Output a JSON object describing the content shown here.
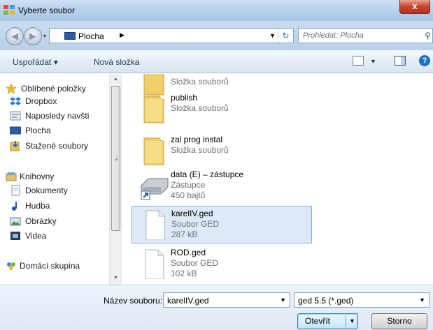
{
  "window": {
    "title": "Vyberte soubor",
    "close_label": "x"
  },
  "address": {
    "location": "Plocha",
    "search_placeholder": "Prohledat: Plocha"
  },
  "toolbar": {
    "organize_label": "Uspořádat ▾",
    "new_folder_label": "Nová složka"
  },
  "sidebar": {
    "favorites": {
      "label": "Oblíbené položky",
      "items": [
        {
          "label": "Dropbox",
          "icon": "dropbox-icon"
        },
        {
          "label": "Naposledy navšti",
          "icon": "recent-places-icon"
        },
        {
          "label": "Plocha",
          "icon": "desktop-icon"
        },
        {
          "label": "Stažené soubory",
          "icon": "downloads-icon"
        }
      ]
    },
    "libraries": {
      "label": "Knihovny",
      "items": [
        {
          "label": "Dokumenty",
          "icon": "documents-icon"
        },
        {
          "label": "Hudba",
          "icon": "music-icon"
        },
        {
          "label": "Obrázky",
          "icon": "pictures-icon"
        },
        {
          "label": "Videa",
          "icon": "videos-icon"
        }
      ]
    },
    "homegroup": {
      "label": "Domácí skupina"
    }
  },
  "files": [
    {
      "name": "",
      "type": "Složka souborů",
      "size": "",
      "kind": "folder"
    },
    {
      "name": "publish",
      "type": "Složka souborů",
      "size": "",
      "kind": "folder"
    },
    {
      "name": "zal prog instal",
      "type": "Složka souborů",
      "size": "",
      "kind": "folder"
    },
    {
      "name": "data (E) – zástupce",
      "type": "Zástupce",
      "size": "450 bajtů",
      "kind": "shortcut"
    },
    {
      "name": "karelIV.ged",
      "type": "Soubor GED",
      "size": "287 kB",
      "kind": "file",
      "selected": true
    },
    {
      "name": "ROD.ged",
      "type": "Soubor GED",
      "size": "102 kB",
      "kind": "file"
    }
  ],
  "footer": {
    "filename_label": "Název souboru:",
    "filename_value": "karelIV.ged",
    "filetype_value": "ged 5.5 (*.ged)",
    "open_label": "Otevřít",
    "cancel_label": "Storno"
  },
  "colors": {
    "selection": "#dde9f8",
    "selection_border": "#84acdd",
    "chrome": "#b9d0ea"
  }
}
